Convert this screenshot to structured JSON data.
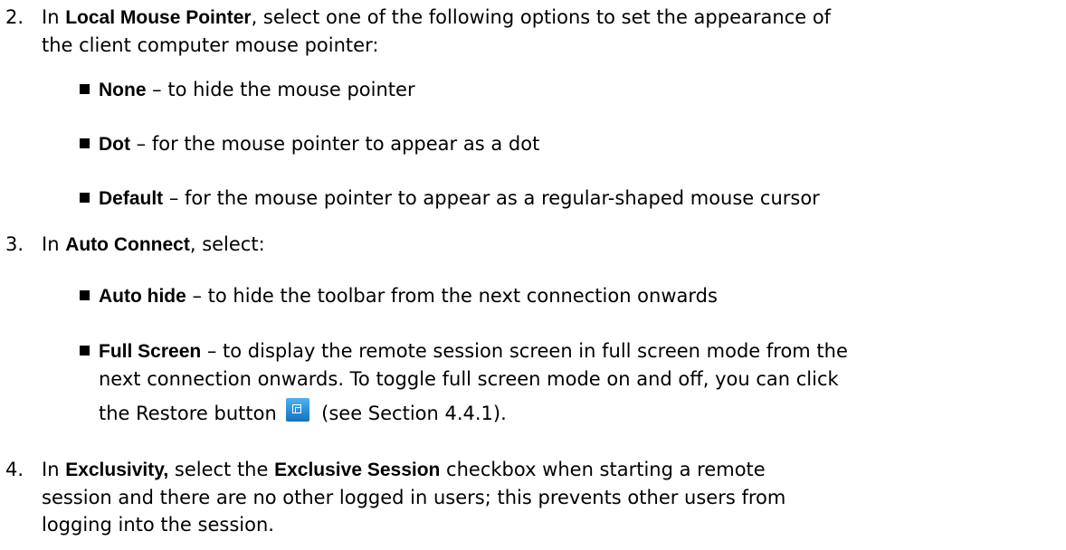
{
  "step2": {
    "number": "2.",
    "prefix": "In ",
    "term": "Local Mouse Pointer",
    "suffix_line1": ", select one of the following options to set the appearance of",
    "line2": "the client computer mouse pointer:",
    "options": [
      {
        "term": "None",
        "text": " – to hide the mouse pointer"
      },
      {
        "term": "Dot",
        "text": " – for the mouse pointer to appear as a dot"
      },
      {
        "term": "Default",
        "text": " – for the mouse pointer to appear as a regular-shaped mouse cursor"
      }
    ]
  },
  "step3": {
    "number": "3.",
    "prefix": "In ",
    "term": "Auto Connect",
    "suffix": ", select:",
    "options": [
      {
        "term": "Auto hide",
        "text": " – to hide the toolbar from the next connection onwards"
      },
      {
        "term": "Full Screen",
        "text_line1": " – to display the remote session screen in full screen mode from the",
        "text_line2": "next connection onwards. To toggle full screen mode on and off, you can click",
        "text_line3_before": "the Restore button",
        "text_line3_after": "(see Section 4.4.1).",
        "icon": "restore-icon"
      }
    ]
  },
  "step4": {
    "number": "4.",
    "prefix": "In ",
    "term1": "Exclusivity,",
    "middle": " select the ",
    "term2": "Exclusive Session",
    "suffix_line1": " checkbox when starting a remote",
    "line2": "session and there are no other logged in users; this prevents other users from",
    "line3": "logging into the session."
  },
  "colors": {
    "text": "#000000",
    "icon_blue": "#2a8fd6"
  }
}
